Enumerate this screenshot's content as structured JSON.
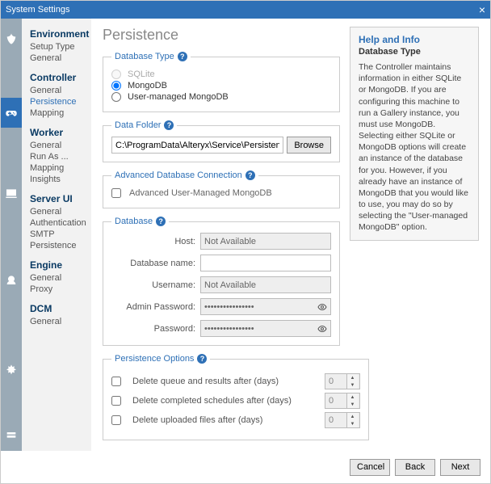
{
  "window": {
    "title": "System Settings"
  },
  "sidebar": {
    "groups": [
      {
        "title": "Environment",
        "items": [
          "Setup Type",
          "General"
        ]
      },
      {
        "title": "Controller",
        "items": [
          "General",
          "Persistence",
          "Mapping"
        ],
        "activeIndex": 1
      },
      {
        "title": "Worker",
        "items": [
          "General",
          "Run As ...",
          "Mapping",
          "Insights"
        ]
      },
      {
        "title": "Server UI",
        "items": [
          "General",
          "Authentication",
          "SMTP",
          "Persistence"
        ]
      },
      {
        "title": "Engine",
        "items": [
          "General",
          "Proxy"
        ]
      },
      {
        "title": "DCM",
        "items": [
          "General"
        ]
      }
    ]
  },
  "page_title": "Persistence",
  "database_type": {
    "legend": "Database Type",
    "options": [
      "SQLite",
      "MongoDB",
      "User-managed MongoDB"
    ],
    "selected": "MongoDB",
    "disabled": [
      "SQLite"
    ]
  },
  "data_folder": {
    "legend": "Data Folder",
    "path": "C:\\ProgramData\\Alteryx\\Service\\Persistence\\MongoDB",
    "browse_label": "Browse"
  },
  "advanced_conn": {
    "legend": "Advanced Database Connection",
    "checkbox_label": "Advanced User-Managed MongoDB",
    "checked": false
  },
  "database": {
    "legend": "Database",
    "host_label": "Host:",
    "host_value": "Not Available",
    "dbname_label": "Database name:",
    "dbname_value": "",
    "username_label": "Username:",
    "username_value": "Not Available",
    "adminpw_label": "Admin Password:",
    "adminpw_value": "••••••••••••••••",
    "pw_label": "Password:",
    "pw_value": "••••••••••••••••"
  },
  "persistence_options": {
    "legend": "Persistence Options",
    "rows": [
      {
        "label": "Delete queue and results after (days)",
        "value": "0",
        "checked": false
      },
      {
        "label": "Delete completed schedules after (days)",
        "value": "0",
        "checked": false
      },
      {
        "label": "Delete uploaded files after (days)",
        "value": "0",
        "checked": false
      }
    ]
  },
  "help": {
    "title": "Help and Info",
    "subtitle": "Database Type",
    "text": "The Controller maintains information in either SQLite or MongoDB. If you are configuring this machine to run a Gallery instance, you must use MongoDB. Selecting either SQLite or MongoDB options will create an instance of the database for you. However, if you already have an instance of MongoDB that you would like to use, you may do so by selecting the \"User-managed MongoDB\" option."
  },
  "footer": {
    "cancel": "Cancel",
    "back": "Back",
    "next": "Next"
  }
}
